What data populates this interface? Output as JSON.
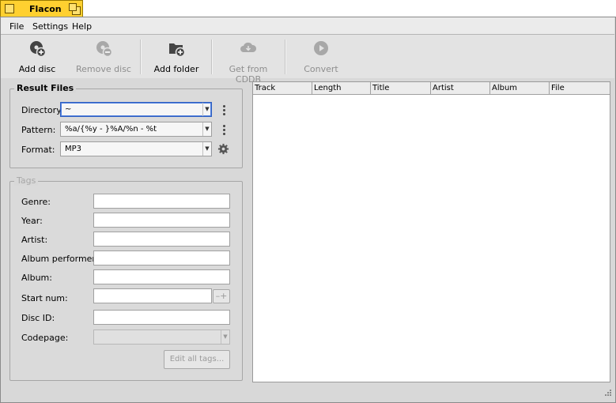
{
  "window": {
    "title": "Flacon"
  },
  "menu": {
    "items": [
      "File",
      "Settings",
      "Help"
    ]
  },
  "toolbar": {
    "add_disc": "Add disc",
    "remove_disc": "Remove disc",
    "add_folder": "Add folder",
    "get_cddb": "Get from CDDB",
    "convert": "Convert"
  },
  "result_files": {
    "title": "Result Files",
    "directory_label": "Directory:",
    "directory_value": "~",
    "pattern_label": "Pattern:",
    "pattern_value": "%a/{%y - }%A/%n - %t",
    "format_label": "Format:",
    "format_value": "MP3"
  },
  "tags": {
    "title": "Tags",
    "genre": "Genre:",
    "year": "Year:",
    "artist": "Artist:",
    "album_performer": "Album performer:",
    "album": "Album:",
    "start_num": "Start num:",
    "disc_id": "Disc ID:",
    "codepage": "Codepage:",
    "edit_all": "Edit all tags..."
  },
  "table": {
    "columns": [
      "Track",
      "Length",
      "Title",
      "Artist",
      "Album",
      "File"
    ]
  },
  "colors": {
    "title_tab": "#ffd030",
    "focus": "#3060c0"
  }
}
